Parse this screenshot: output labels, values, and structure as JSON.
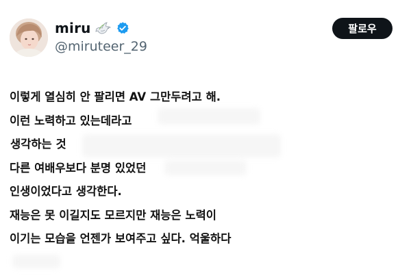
{
  "header": {
    "display_name": "miru",
    "handle": "@miruteer_29",
    "follow_label": "팔로우",
    "icons": [
      "dove-icon",
      "verified-icon"
    ],
    "verified_color": "#1d9bf0"
  },
  "post": {
    "lines": [
      "이렇게 열심히 안 팔리면 AV 그만두려고 해.",
      "이런 노력하고 있는데라고",
      "생각하는 것",
      "다른 여배우보다 분명 있었던",
      "인생이었다고 생각한다.",
      "재능은 못 이길지도 모르지만 재능은 노력이",
      "이기는 모습을 언젠가 보여주고 싶다. 억울하다"
    ]
  }
}
